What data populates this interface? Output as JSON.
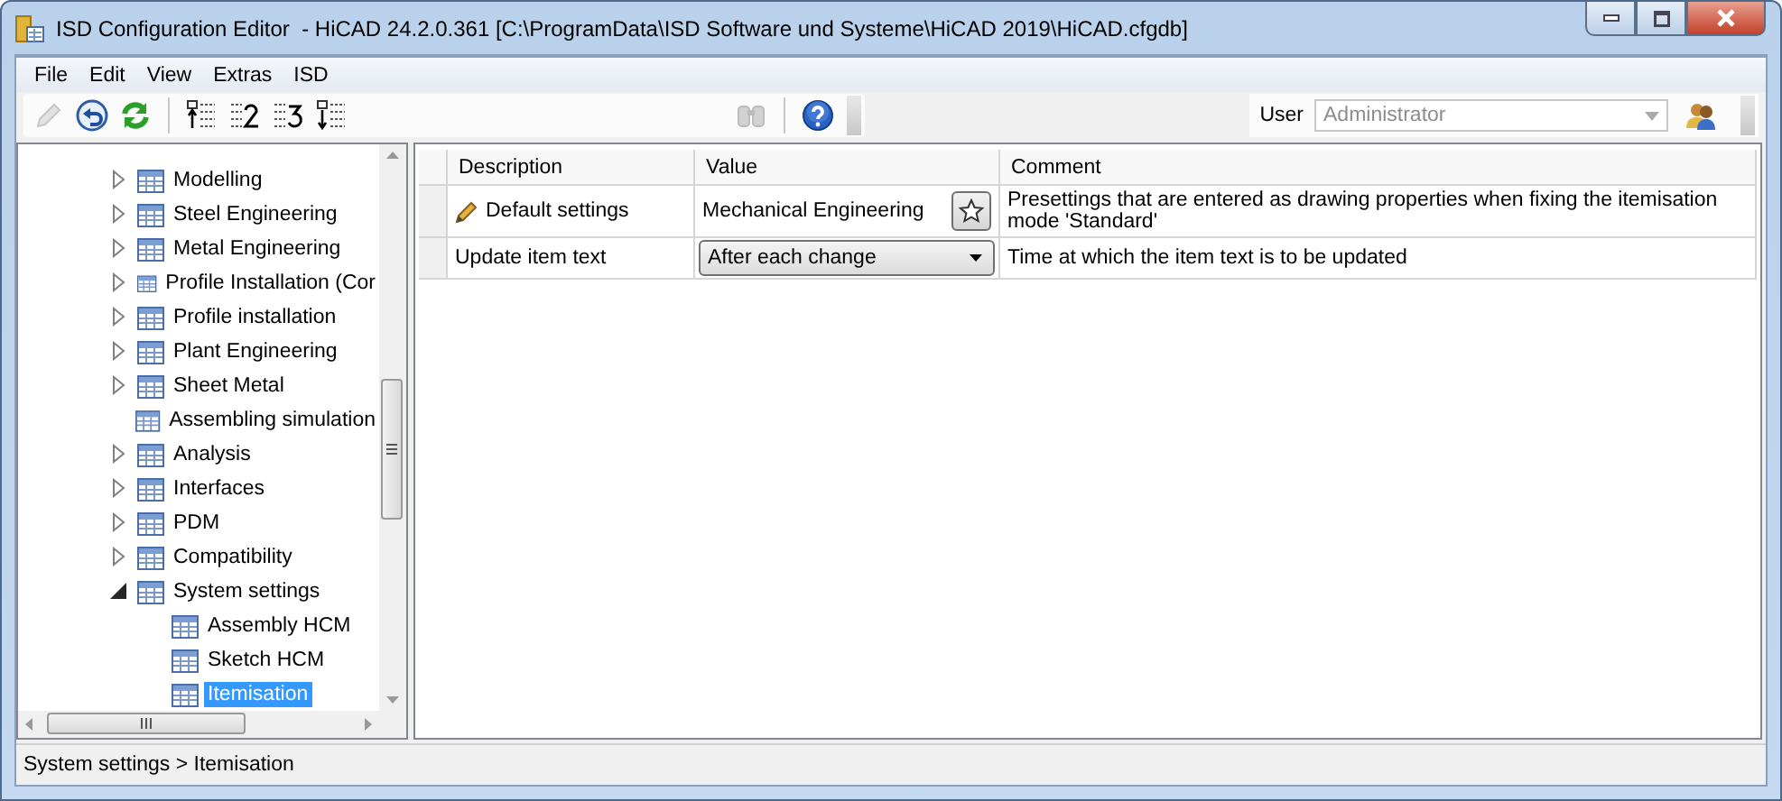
{
  "window": {
    "title": "ISD Configuration Editor  - HiCAD 24.2.0.361 [C:\\ProgramData\\ISD Software und Systeme\\HiCAD 2019\\HiCAD.cfgdb]"
  },
  "menu": [
    "File",
    "Edit",
    "View",
    "Extras",
    "ISD"
  ],
  "toolbar": {
    "buttons": [
      {
        "kind": "edit",
        "disabled": true
      },
      {
        "kind": "undo",
        "disabled": false
      },
      {
        "kind": "refresh",
        "disabled": false
      },
      {
        "kind": "separator"
      },
      {
        "kind": "list-up",
        "disabled": false
      },
      {
        "kind": "level-2",
        "disabled": false
      },
      {
        "kind": "level-3",
        "disabled": false
      },
      {
        "kind": "list-down",
        "disabled": false
      },
      {
        "kind": "spacer"
      },
      {
        "kind": "find",
        "disabled": true
      },
      {
        "kind": "separator"
      },
      {
        "kind": "help",
        "disabled": false
      }
    ],
    "user": {
      "label": "User",
      "value": "Administrator",
      "disabled": true
    }
  },
  "tree": {
    "items": [
      {
        "label": "Modelling",
        "expandable": true,
        "expanded": false,
        "selected": false
      },
      {
        "label": "Steel Engineering",
        "expandable": true,
        "expanded": false,
        "selected": false
      },
      {
        "label": "Metal Engineering",
        "expandable": true,
        "expanded": false,
        "selected": false
      },
      {
        "label": "Profile Installation (Cor",
        "expandable": true,
        "expanded": false,
        "selected": false
      },
      {
        "label": "Profile installation",
        "expandable": true,
        "expanded": false,
        "selected": false
      },
      {
        "label": "Plant Engineering",
        "expandable": true,
        "expanded": false,
        "selected": false
      },
      {
        "label": "Sheet Metal",
        "expandable": true,
        "expanded": false,
        "selected": false
      },
      {
        "label": "Assembling simulation",
        "expandable": false,
        "selected": false
      },
      {
        "label": "Analysis",
        "expandable": true,
        "expanded": false,
        "selected": false
      },
      {
        "label": "Interfaces",
        "expandable": true,
        "expanded": false,
        "selected": false
      },
      {
        "label": "PDM",
        "expandable": true,
        "expanded": false,
        "selected": false
      },
      {
        "label": "Compatibility",
        "expandable": true,
        "expanded": false,
        "selected": false
      },
      {
        "label": "System settings",
        "expandable": true,
        "expanded": true,
        "selected": false,
        "children": [
          {
            "label": "Assembly HCM",
            "expandable": false,
            "selected": false
          },
          {
            "label": "Sketch HCM",
            "expandable": false,
            "selected": false
          },
          {
            "label": "Itemisation",
            "expandable": false,
            "selected": true
          }
        ]
      }
    ]
  },
  "table": {
    "columns": [
      "Description",
      "Value",
      "Comment"
    ],
    "rows": [
      {
        "description": "Default settings",
        "edited": true,
        "kind": "button",
        "value": "Mechanical Engineering",
        "comment": "Presettings that are entered as drawing properties when fixing the itemisation mode 'Standard'"
      },
      {
        "description": "Update item text",
        "edited": false,
        "kind": "dropdown",
        "value": "After each change",
        "comment": "Time at which the item text is to be updated"
      }
    ]
  },
  "status_bar": "System settings > Itemisation"
}
